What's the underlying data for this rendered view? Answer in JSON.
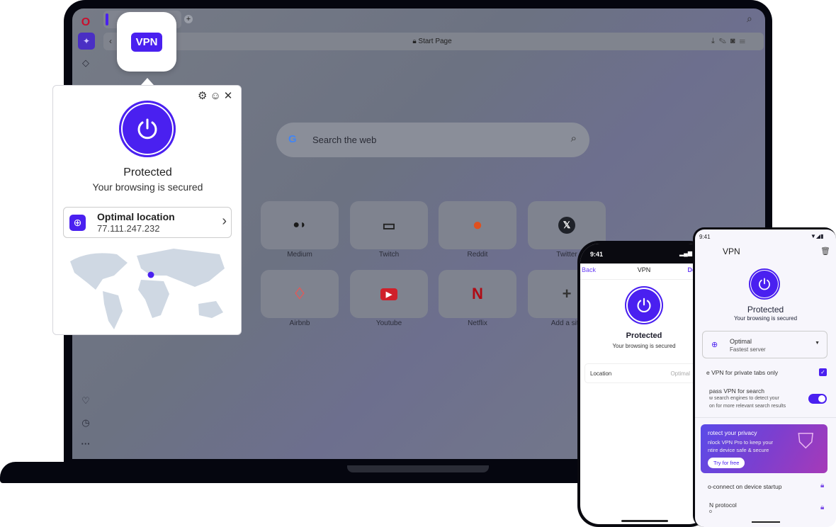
{
  "browser": {
    "address": "Start Page",
    "search_placeholder": "Search the web",
    "speed_dials": [
      {
        "label": "Medium",
        "icon": "medium-icon"
      },
      {
        "label": "Twitch",
        "icon": "twitch-icon"
      },
      {
        "label": "Reddit",
        "icon": "reddit-icon"
      },
      {
        "label": "Twitter",
        "icon": "x-icon"
      },
      {
        "label": "Airbnb",
        "icon": "airbnb-icon"
      },
      {
        "label": "Youtube",
        "icon": "youtube-icon"
      },
      {
        "label": "Netflix",
        "icon": "netflix-icon"
      },
      {
        "label": "Add a site",
        "icon": "plus-icon"
      }
    ]
  },
  "vpn_badge": "VPN",
  "popup": {
    "status": "Protected",
    "subtitle": "Your browsing is secured",
    "location_title": "Optimal location",
    "ip": "77.111.247.232"
  },
  "ios": {
    "time": "9:41",
    "back": "Back",
    "title": "VPN",
    "done": "Done",
    "status": "Protected",
    "subtitle": "Your browsing is secured",
    "location_label": "Location",
    "location_value": "Optimal"
  },
  "android": {
    "time": "9:41",
    "title": "VPN",
    "status": "Protected",
    "subtitle": "Your browsing is secured",
    "server_title": "Optimal",
    "server_sub": "Fastest server",
    "private_tabs": "e VPN for private tabs only",
    "bypass_title": "pass VPN for search",
    "bypass_desc1": "w search engines to detect your",
    "bypass_desc2": "on for more relevant search results",
    "promo_title": "rotect your privacy",
    "promo_line1": "nlock VPN Pro to keep your",
    "promo_line2": "ntire device safe & secure",
    "promo_button": "Try for free",
    "autoconnect": "o-connect on device startup",
    "protocol": "N protocol",
    "protocol_sub": "o"
  },
  "colors": {
    "accent": "#4a20f0",
    "bezel": "#05060f"
  }
}
